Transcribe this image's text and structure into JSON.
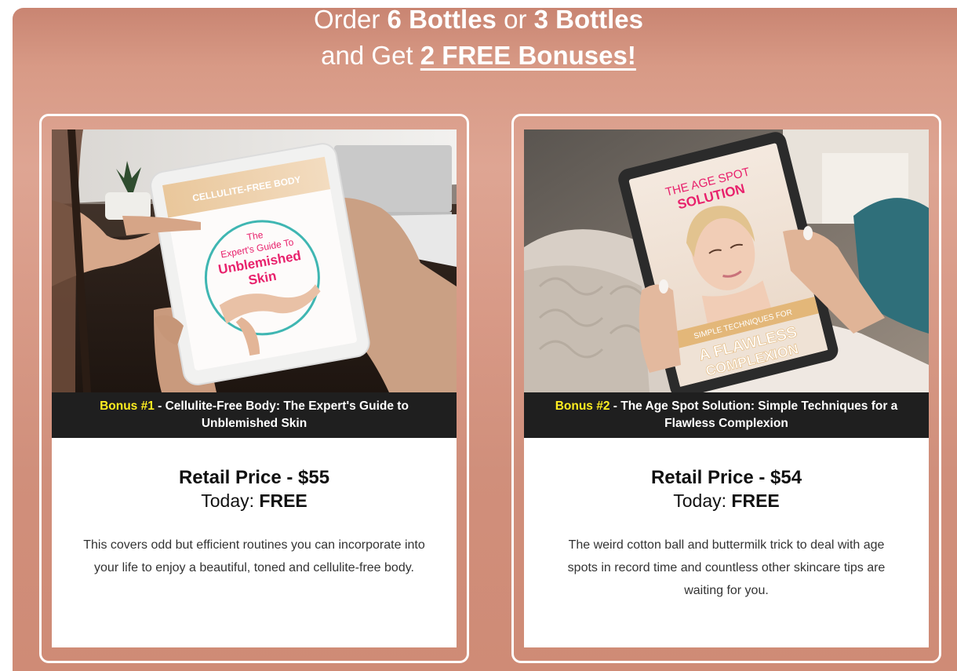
{
  "headline": {
    "line1_prefix": "Order ",
    "line1_bold1": "6 Bottles",
    "line1_mid": " or ",
    "line1_bold2": "3 Bottles",
    "line2_prefix": "and Get ",
    "line2_bold": "2 FREE Bonuses!"
  },
  "bonuses": [
    {
      "image_texts": {
        "banner": "CELLULITE-FREE BODY",
        "line1": "The",
        "line2": "Expert's Guide To",
        "line3": "Unblemished",
        "line4": "Skin"
      },
      "caption_tag": "Bonus #1",
      "caption_text": " - Cellulite-Free Body: The Expert's Guide to Unblemished Skin",
      "retail": "Retail Price - $55",
      "today_prefix": "Today: ",
      "today_value": "FREE",
      "description": "This covers odd but efficient routines you can incorporate into your life to enjoy a beautiful, toned and cellulite-free body."
    },
    {
      "image_texts": {
        "line1": "THE AGE SPOT",
        "line2": "SOLUTION",
        "line3": "SIMPLE TECHNIQUES FOR",
        "line4": "A FLAWLESS",
        "line5": "COMPLEXION"
      },
      "caption_tag": "Bonus #2",
      "caption_text": " - The Age Spot Solution: Simple Techniques for a Flawless Complexion",
      "retail": "Retail Price - $54",
      "today_prefix": "Today: ",
      "today_value": "FREE",
      "description": "The weird cotton ball and buttermilk trick to deal with age spots in record time and countless other skincare tips are waiting for you."
    }
  ],
  "colors": {
    "panel": "#d89a86",
    "caption_bg": "#1f1f1f",
    "caption_highlight": "#ffee20",
    "accent_pink": "#e8216c"
  }
}
